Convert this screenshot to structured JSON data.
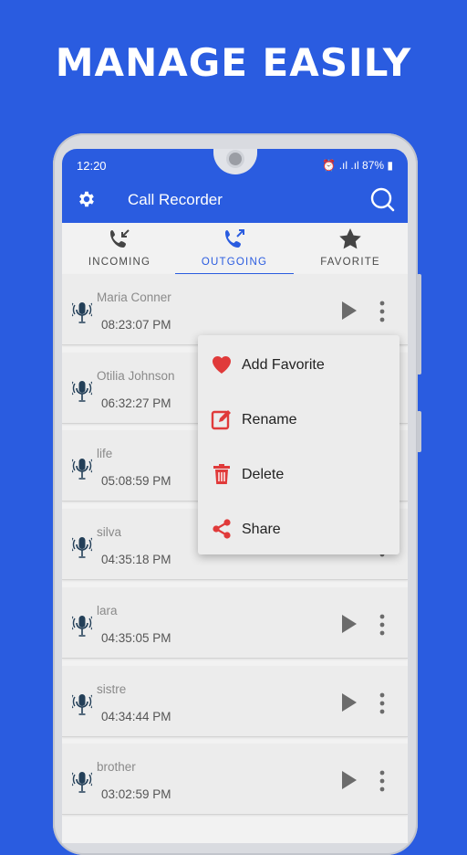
{
  "headline": "MANAGE EASILY",
  "status": {
    "time": "12:20",
    "battery": "87%",
    "icons": "⏰ .ıl .ıl 87% ▮"
  },
  "app": {
    "title": "Call Recorder",
    "settings_icon": "gear-icon",
    "search_icon": "search-icon"
  },
  "tabs": [
    {
      "label": "INCOMING",
      "icon": "incoming-call-icon",
      "active": false
    },
    {
      "label": "OUTGOING",
      "icon": "outgoing-call-icon",
      "active": true
    },
    {
      "label": "FAVORITE",
      "icon": "star-icon",
      "active": false
    }
  ],
  "recordings": [
    {
      "name": "Maria Conner",
      "time": "08:23:07 PM"
    },
    {
      "name": "Otilia Johnson",
      "time": "06:32:27 PM"
    },
    {
      "name": "life",
      "time": "05:08:59 PM"
    },
    {
      "name": "silva",
      "time": "04:35:18 PM"
    },
    {
      "name": "lara",
      "time": "04:35:05 PM"
    },
    {
      "name": "sistre",
      "time": "04:34:44 PM"
    },
    {
      "name": "brother",
      "time": "03:02:59 PM"
    }
  ],
  "context_menu": [
    {
      "label": "Add Favorite",
      "icon": "heart-icon"
    },
    {
      "label": "Rename",
      "icon": "edit-icon"
    },
    {
      "label": "Delete",
      "icon": "trash-icon"
    },
    {
      "label": "Share",
      "icon": "share-icon"
    }
  ],
  "colors": {
    "brand": "#2a5ce0",
    "accent_red": "#e03a3a",
    "icon_dark": "#233f58"
  }
}
